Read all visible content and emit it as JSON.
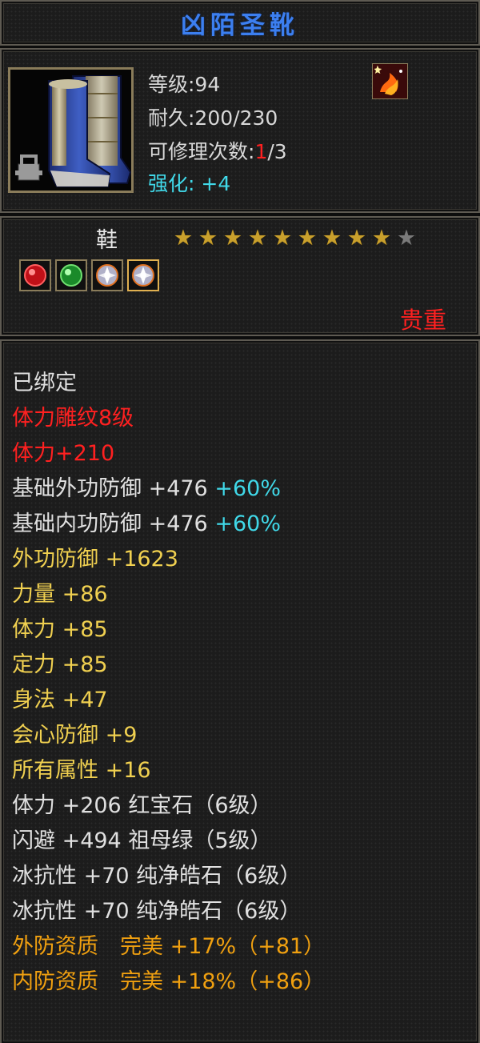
{
  "title": "凶陌圣靴",
  "header": {
    "level_label": "等级:94",
    "durability_label": "耐久:200/230",
    "repair_prefix": "可修理次数:",
    "repair_current": "1",
    "repair_suffix": "/3",
    "enhance_label": "强化:",
    "enhance_value": "+4",
    "item_icon": "blue-boots-icon",
    "skill_icon": "fire-rune-icon"
  },
  "info": {
    "slot_type": "鞋",
    "stars_filled": 9,
    "stars_total": 10,
    "gems": [
      "ruby-gem-icon",
      "emerald-gem-icon",
      "diamond-gem-icon",
      "diamond-gem-icon"
    ],
    "rarity": "贵重"
  },
  "attributes": {
    "bound": "已绑定",
    "carve": "体力雕纹8级",
    "carve_bonus": "体力+210",
    "base_ext_def_label": "基础外功防御 +476",
    "base_ext_def_pct": "+60%",
    "base_int_def_label": "基础内功防御 +476",
    "base_int_def_pct": "+60%",
    "ext_def": "外功防御 +1623",
    "strength": "力量 +86",
    "stamina": "体力 +85",
    "focus": "定力 +85",
    "agility": "身法 +47",
    "crit_def": "会心防御 +9",
    "all_attr": "所有属性 +16",
    "gem_line1": "体力 +206 红宝石（6级）",
    "gem_line2": "闪避 +494 祖母绿（5级）",
    "gem_line3": "冰抗性 +70 纯净皓石（6级）",
    "gem_line4": "冰抗性 +70 纯净皓石（6级）",
    "aptitude_ext": "外防资质　完美 +17%（+81）",
    "aptitude_int": "内防资质　完美 +18%（+86）"
  },
  "colors": {
    "title": "#3c7ff0",
    "enhance": "#40d8e8",
    "red": "#ff2020",
    "yellow": "#f0d050",
    "orange": "#f0a010",
    "star_on": "#c9a02c",
    "star_off": "#7a7a7a"
  }
}
